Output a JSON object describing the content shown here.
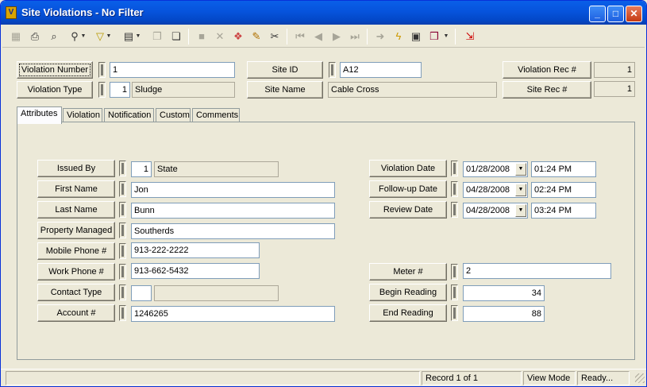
{
  "window": {
    "title": "Site Violations - No Filter",
    "app_icon": "app-icon"
  },
  "toolbar": {
    "icons": [
      "grid-icon",
      "print-icon",
      "print-preview-icon",
      "find-icon",
      "filter-icon",
      "report-icon",
      "copy-icon",
      "paste-icon",
      "save-icon",
      "delete-icon",
      "undo-icon",
      "edit-icon",
      "cut-icon",
      "first-record-icon",
      "previous-record-icon",
      "next-record-icon",
      "last-record-icon",
      "go-icon",
      "lightning-icon",
      "wizard-icon",
      "book-icon",
      "exit-icon"
    ]
  },
  "header": {
    "violation_number_label": "Violation Number",
    "violation_number": "1",
    "violation_type_label": "Violation Type",
    "violation_type_code": "1",
    "violation_type_name": "Sludge",
    "site_id_label": "Site ID",
    "site_id": "A12",
    "site_name_label": "Site Name",
    "site_name": "Cable Cross",
    "violation_rec_label": "Violation Rec #",
    "violation_rec": "1",
    "site_rec_label": "Site Rec #",
    "site_rec": "1"
  },
  "tabs": [
    "Attributes",
    "Violation",
    "Notification",
    "Custom",
    "Comments"
  ],
  "attributes": {
    "issued_by_label": "Issued By",
    "issued_by_code": "1",
    "issued_by_name": "State",
    "first_name_label": "First Name",
    "first_name": "Jon",
    "last_name_label": "Last Name",
    "last_name": "Bunn",
    "property_managed_label": "Property Managed",
    "property_managed": "Southerds",
    "mobile_phone_label": "Mobile Phone #",
    "mobile_phone": "913-222-2222",
    "work_phone_label": "Work Phone #",
    "work_phone": "913-662-5432",
    "contact_type_label": "Contact Type",
    "contact_type_code": "",
    "contact_type_name": "",
    "account_label": "Account #",
    "account": "1246265",
    "violation_date_label": "Violation Date",
    "violation_date": "01/28/2008",
    "violation_time": "01:24 PM",
    "followup_date_label": "Follow-up Date",
    "followup_date": "04/28/2008",
    "followup_time": "02:24 PM",
    "review_date_label": "Review Date",
    "review_date": "04/28/2008",
    "review_time": "03:24 PM",
    "meter_label": "Meter #",
    "meter": "2",
    "begin_reading_label": "Begin Reading",
    "begin_reading": "34",
    "end_reading_label": "End Reading",
    "end_reading": "88"
  },
  "status": {
    "record": "Record 1 of 1",
    "mode": "View Mode",
    "state": "Ready..."
  }
}
